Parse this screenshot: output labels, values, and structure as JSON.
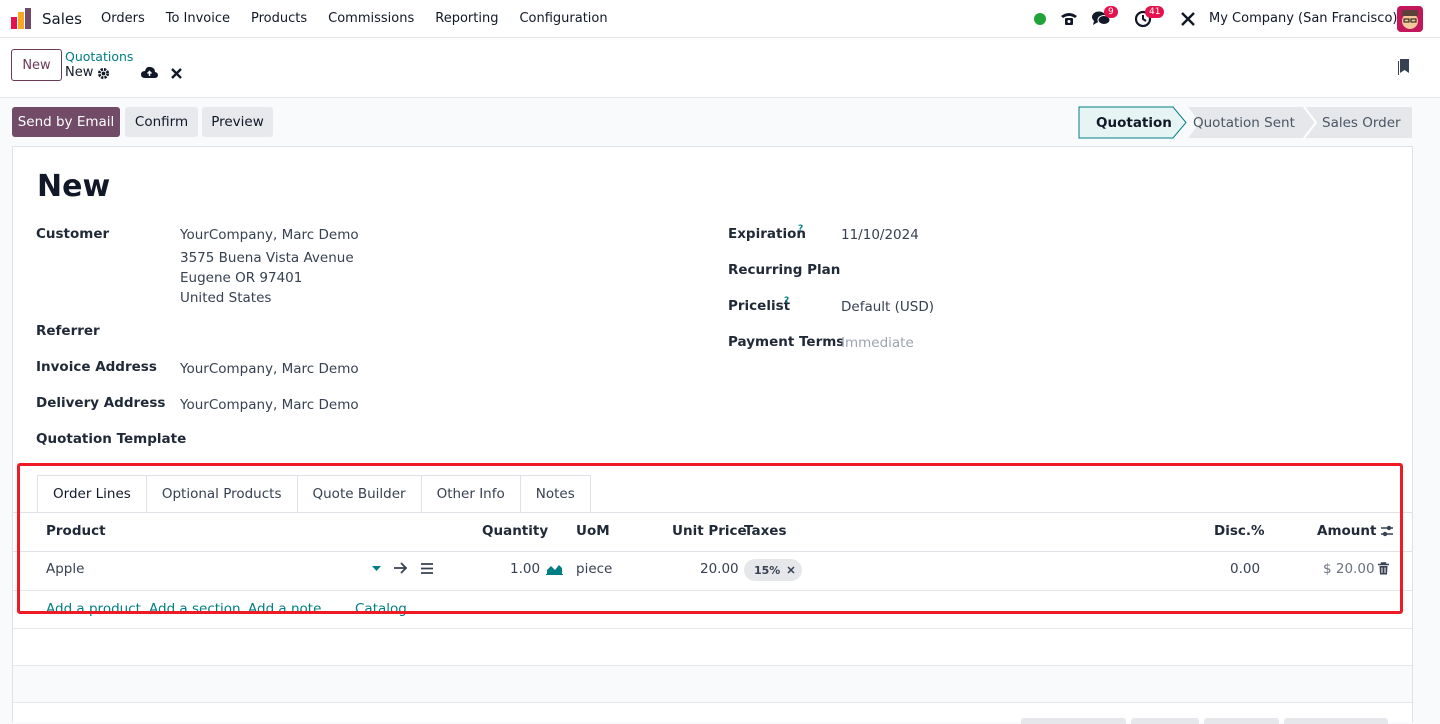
{
  "navbar": {
    "app_name": "Sales",
    "menu": [
      "Orders",
      "To Invoice",
      "Products",
      "Commissions",
      "Reporting",
      "Configuration"
    ],
    "messages_count": "9",
    "activities_count": "41",
    "company": "My Company (San Francisco)"
  },
  "control_panel": {
    "new_label": "New",
    "breadcrumb_parent": "Quotations",
    "breadcrumb_current": "New"
  },
  "actions": {
    "send_email": "Send by Email",
    "confirm": "Confirm",
    "preview": "Preview"
  },
  "statusbar": [
    "Quotation",
    "Quotation Sent",
    "Sales Order"
  ],
  "form": {
    "title": "New",
    "customer_label": "Customer",
    "customer_lines": [
      "YourCompany, Marc Demo",
      "3575 Buena Vista Avenue",
      "Eugene OR 97401",
      "United States"
    ],
    "referrer_label": "Referrer",
    "invoice_address_label": "Invoice Address",
    "invoice_address": "YourCompany, Marc Demo",
    "delivery_address_label": "Delivery Address",
    "delivery_address": "YourCompany, Marc Demo",
    "template_label": "Quotation Template",
    "expiration_label": "Expiration",
    "expiration": "11/10/2024",
    "recurring_label": "Recurring Plan",
    "pricelist_label": "Pricelist",
    "pricelist": "Default (USD)",
    "payment_terms_label": "Payment Terms",
    "payment_terms_placeholder": "Immediate",
    "help_mark": "?"
  },
  "tabs": [
    "Order Lines",
    "Optional Products",
    "Quote Builder",
    "Other Info",
    "Notes"
  ],
  "order_lines": {
    "columns": {
      "product": "Product",
      "quantity": "Quantity",
      "uom": "UoM",
      "unit_price": "Unit Price",
      "taxes": "Taxes",
      "discount": "Disc.%",
      "amount": "Amount"
    },
    "rows": [
      {
        "product": "Apple",
        "quantity": "1.00",
        "uom": "piece",
        "unit_price": "20.00",
        "tax": "15%",
        "discount": "0.00",
        "amount": "$ 20.00"
      }
    ],
    "links": [
      "Add a product",
      "Add a section",
      "Add a note",
      "Catalog"
    ]
  },
  "colors": {
    "primary": "#714b67",
    "link": "#017e84",
    "highlight_box": "#ee1b24",
    "online": "#22a33a"
  }
}
